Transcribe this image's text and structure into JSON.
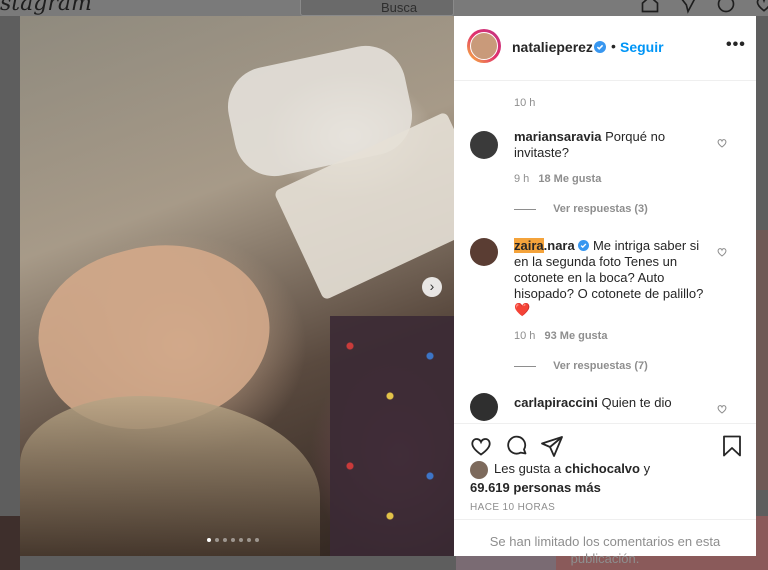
{
  "background": {
    "logo": "stagram",
    "search_placeholder": "Busca"
  },
  "post": {
    "username": "natalieperez",
    "follow_label": "Seguir",
    "separator": "•",
    "more_label": "•••",
    "top_time": "10 h",
    "image_count": 7,
    "active_image": 1
  },
  "comments": [
    {
      "username": "mariansaravia",
      "text": "Porqué no invitaste?",
      "time": "9 h",
      "likes": "18 Me gusta",
      "replies": "Ver respuestas (3)"
    },
    {
      "username_highlight": "zaira",
      "username_rest": ".nara",
      "text": "Me intriga saber si en la segunda foto Tenes un cotonete en la boca? Auto hisopado? O cotonete de palillo?❤️",
      "time": "10 h",
      "likes": "93 Me gusta",
      "replies": "Ver respuestas (7)"
    },
    {
      "username": "carlapiraccini",
      "text": "Quien te dio"
    }
  ],
  "likes": {
    "prefix": "Les gusta a",
    "user": "chichocalvo",
    "conj": "y",
    "count": "69.619 personas más"
  },
  "posted": "HACE 10 HORAS",
  "limited_text": "Se han limitado los comentarios en esta publicación.",
  "colors": {
    "accent": "#0095f6",
    "highlight": "#f4a33b",
    "verified": "#3897f0"
  }
}
